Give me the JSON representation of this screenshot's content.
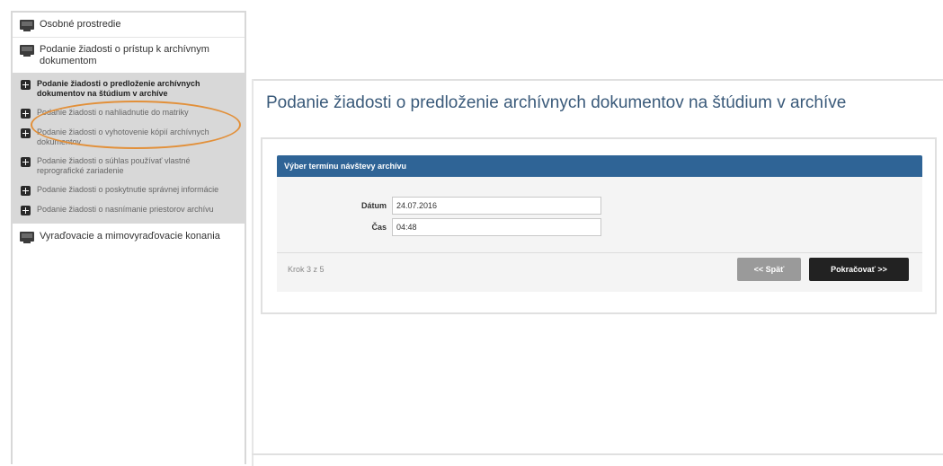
{
  "sidebar": {
    "items": [
      {
        "label": "Osobné prostredie",
        "icon": "monitor-icon"
      },
      {
        "label": "Podanie žiadosti o prístup k archívnym dokumentom",
        "icon": "monitor-icon"
      }
    ],
    "sub_items": [
      {
        "label": "Podanie žiadosti o predloženie archívnych dokumentov na štúdium v archíve",
        "active": true
      },
      {
        "label": "Podanie žiadosti o nahliadnutie do matriky"
      },
      {
        "label": "Podanie žiadosti o vyhotovenie kópií archívnych dokumentov"
      },
      {
        "label": "Podanie žiadosti o súhlas používať vlastné reprografické zariadenie"
      },
      {
        "label": "Podanie žiadosti o poskytnutie správnej informácie"
      },
      {
        "label": "Podanie žiadosti o nasnímanie priestorov archívu"
      }
    ],
    "bottom_item": {
      "label": "Vyraďovacie a mimovyraďovacie konania",
      "icon": "monitor-icon"
    },
    "highlight_color": "#e2903a"
  },
  "main": {
    "title": "Podanie žiadosti o predloženie archívnych dokumentov na štúdium v archíve",
    "panel": {
      "header": "Výber termínu návštevy archívu",
      "fields": [
        {
          "label": "Dátum",
          "value": "24.07.2016"
        },
        {
          "label": "Čas",
          "value": "04:48"
        }
      ],
      "step": "Krok 3 z 5",
      "back_label": "<< Späť",
      "next_label": "Pokračovať >>"
    }
  },
  "colors": {
    "header_blue": "#2f6496",
    "title_blue": "#3a5a7a",
    "back_button": "#9a9a9a",
    "next_button": "#222222"
  }
}
